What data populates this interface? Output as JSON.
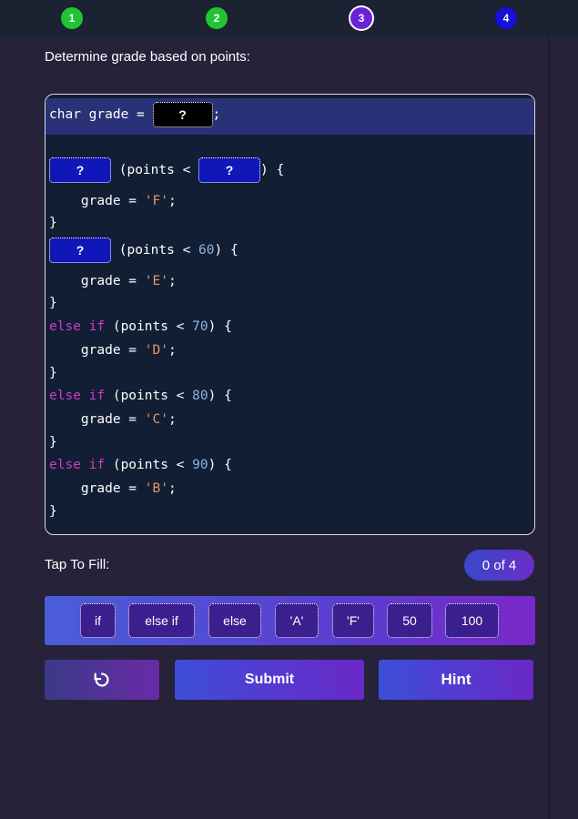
{
  "steps": [
    {
      "label": "1",
      "state": "done"
    },
    {
      "label": "2",
      "state": "done"
    },
    {
      "label": "3",
      "state": "current"
    },
    {
      "label": "4",
      "state": "todo"
    }
  ],
  "prompt": "Determine grade based on points:",
  "code": {
    "line1": {
      "pre": "char grade = ",
      "blank": "?",
      "post": ";"
    },
    "line2": {
      "blank1": "?",
      "mid": " (points < ",
      "blank2": "?",
      "post": ") {"
    },
    "line3": {
      "pre": "    grade = ",
      "str": "'F'",
      "post": ";"
    },
    "line4": "}",
    "line5": {
      "blank": "?",
      "pre": " (points < ",
      "num": "60",
      "post": ") {"
    },
    "line6": {
      "pre": "    grade = ",
      "str": "'E'",
      "post": ";"
    },
    "line7": "}",
    "line8": {
      "kw": "else if",
      "pre": " (points < ",
      "num": "70",
      "post": ") {"
    },
    "line9": {
      "pre": "    grade = ",
      "str": "'D'",
      "post": ";"
    },
    "line10": "}",
    "line11": {
      "kw": "else if",
      "pre": " (points < ",
      "num": "80",
      "post": ") {"
    },
    "line12": {
      "pre": "    grade = ",
      "str": "'C'",
      "post": ";"
    },
    "line13": "}",
    "line14": {
      "kw": "else if",
      "pre": " (points < ",
      "num": "90",
      "post": ") {"
    },
    "line15": {
      "pre": "    grade = ",
      "str": "'B'",
      "post": ";"
    },
    "line16": "}"
  },
  "tap_label": "Tap To Fill:",
  "counter": "0 of 4",
  "chips": [
    "if",
    "else if",
    "else",
    "'A'",
    "'F'",
    "50",
    "100"
  ],
  "buttons": {
    "reset_icon": "reset-icon",
    "submit": "Submit",
    "hint": "Hint"
  },
  "colors": {
    "background": "#262239",
    "code_bg": "#121e33",
    "keyword": "#d23cc8",
    "number": "#8fb4e0",
    "string": "#e8956a",
    "blank": "#0f17b8",
    "step_done": "#22c432",
    "step_current": "#6a22d8",
    "step_todo": "#1710d8"
  }
}
